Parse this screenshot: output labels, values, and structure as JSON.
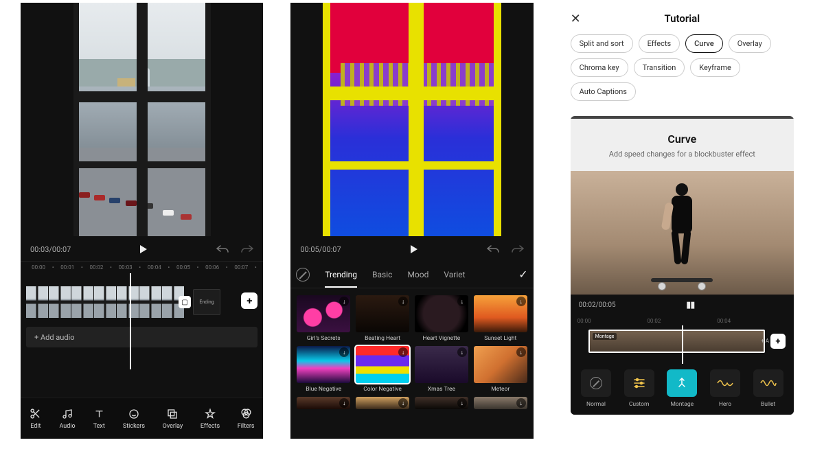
{
  "screen1": {
    "time_display": "00:03/00:07",
    "ruler": [
      "00:00",
      "00:01",
      "00:02",
      "00:03",
      "00:04",
      "00:05",
      "00:06",
      "00:07"
    ],
    "ending_label": "Ending",
    "add_audio_label": "+   Add audio",
    "add_clip_label": "+",
    "tools": [
      {
        "icon": "scissors-icon",
        "label": "Edit"
      },
      {
        "icon": "audio-icon",
        "label": "Audio"
      },
      {
        "icon": "text-icon",
        "label": "Text"
      },
      {
        "icon": "stickers-icon",
        "label": "Stickers"
      },
      {
        "icon": "overlay-icon",
        "label": "Overlay"
      },
      {
        "icon": "effects-icon",
        "label": "Effects"
      },
      {
        "icon": "filters-icon",
        "label": "Filters"
      }
    ]
  },
  "screen2": {
    "time_display": "00:05/00:07",
    "tabs": [
      "Trending",
      "Basic",
      "Mood",
      "Variet"
    ],
    "active_tab": "Trending",
    "selected_effect": "Color Negative",
    "effects": [
      {
        "label": "Girl's Secrets"
      },
      {
        "label": "Beating Heart"
      },
      {
        "label": "Heart Vignette"
      },
      {
        "label": "Sunset Light"
      },
      {
        "label": "Blue Negative"
      },
      {
        "label": "Color Negative"
      },
      {
        "label": "Xmas Tree"
      },
      {
        "label": "Meteor"
      }
    ]
  },
  "screen3": {
    "title": "Tutorial",
    "chips": [
      "Split and sort",
      "Effects",
      "Curve",
      "Overlay",
      "Chroma key",
      "Transition",
      "Keyframe",
      "Auto Captions"
    ],
    "active_chip": "Curve",
    "card": {
      "heading": "Curve",
      "subtitle": "Add speed changes for a blockbuster effect"
    },
    "mini": {
      "time_display": "00:02/00:05",
      "ruler": [
        "00:00",
        "00:02",
        "00:04"
      ],
      "clip_tag": "Montage",
      "add_label": "+ A",
      "add_btn": "+"
    },
    "curve_tools": [
      {
        "key": "normal",
        "label": "Normal"
      },
      {
        "key": "custom",
        "label": "Custom"
      },
      {
        "key": "montage",
        "label": "Montage"
      },
      {
        "key": "hero",
        "label": "Hero"
      },
      {
        "key": "bullet",
        "label": "Bullet"
      }
    ],
    "active_curve_tool": "montage"
  }
}
